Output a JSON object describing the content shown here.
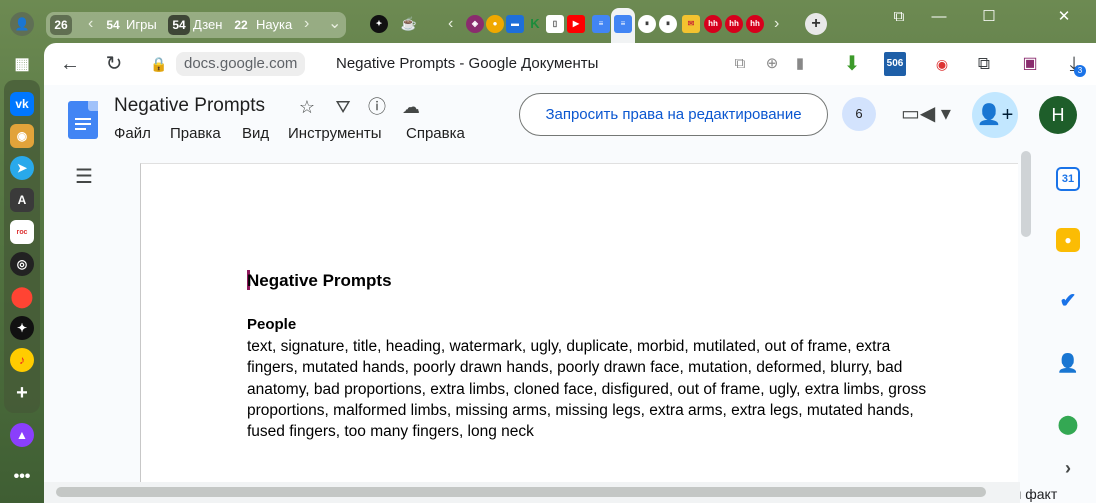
{
  "tabs": {
    "groups": [
      {
        "count": "26",
        "label": ""
      },
      {
        "count": "54",
        "label": "Игры"
      },
      {
        "count": "54",
        "label": "Дзен"
      },
      {
        "count": "22",
        "label": "Наука"
      }
    ],
    "pinned_favicons": [
      "star-logo-icon",
      "coffee-icon"
    ],
    "favicons": [
      "arrow-left-icon",
      "multi-icon",
      "rambler-icon",
      "kinopoisk-icon",
      "doc-icon",
      "docs-icon",
      "docs-active-icon",
      "pause-icon",
      "pause-icon",
      "gmail-icon",
      "hh-icon",
      "hh-icon",
      "hh-icon"
    ],
    "hh_label": "hh",
    "new_tab_label": "+"
  },
  "window_controls": {
    "minimize": "—",
    "restore": "☐",
    "close": "✕"
  },
  "address_bar": {
    "domain": "docs.google.com",
    "page_title": "Negative Prompts - Google Документы",
    "badge_506": "506",
    "download_badge": "3"
  },
  "docs": {
    "title": "Negative Prompts",
    "menu": [
      "Файл",
      "Правка",
      "Вид",
      "Инструменты",
      "Справка"
    ],
    "request_edit_button": "Запросить права на редактирование",
    "viewers_count": "6",
    "avatar_initial": "Н"
  },
  "document": {
    "heading": "Negative Prompts",
    "section_title": "People",
    "section_body": "text, signature, title, heading, watermark, ugly, duplicate, morbid, mutilated, out of frame, extra fingers, mutated hands, poorly drawn hands, poorly drawn face, mutation, deformed, blurry, bad anatomy, bad proportions, extra limbs, cloned face, disfigured, out of frame, ugly, extra limbs, gross proportions, malformed limbs, missing arms, missing legs, extra arms, extra legs, mutated hands, fused fingers, too many fingers, long neck"
  },
  "side_panel": {
    "calendar_day": "31"
  },
  "below_text": "вопрос, каждое сомнение или факт",
  "colors": {
    "docs_blue": "#4285f4",
    "accent_blue": "#0b57d0",
    "avatar_green": "#1e5e2a",
    "cursor": "#8e1a5c"
  }
}
